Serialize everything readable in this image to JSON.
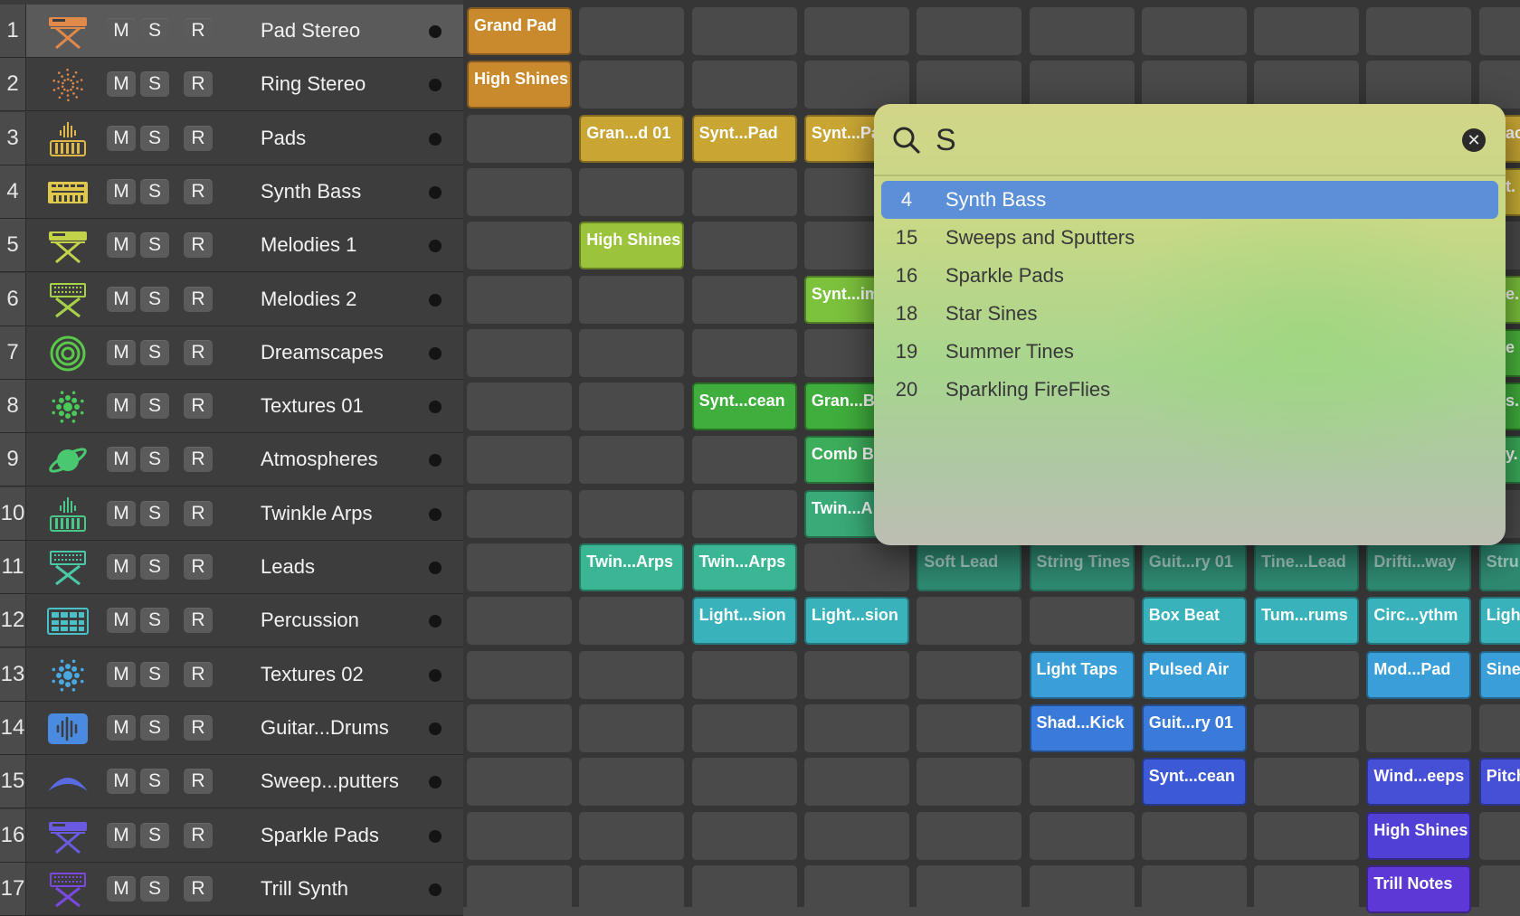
{
  "colors": {
    "yellow_orange": "#c98a2e",
    "gold": "#c9a634",
    "lime": "#9bc43c",
    "green": "#3fae3c",
    "green2": "#3cad5a",
    "teal_green": "#3aab78",
    "teal": "#39b2a2",
    "cyan": "#36a9c3",
    "sky": "#3a8ed8",
    "blue": "#3a6cd8",
    "indigo": "#4b4fd8",
    "violet": "#5d42d8",
    "selection": "#5b8fd8"
  },
  "tracks": [
    {
      "num": "1",
      "name": "Pad Stereo",
      "icon": "synth-stand-icon",
      "color": "#e0894a",
      "controls": [
        "M",
        "S",
        "R"
      ],
      "selected": true
    },
    {
      "num": "2",
      "name": "Ring Stereo",
      "icon": "dots-ring-icon",
      "color": "#e0894a",
      "controls": [
        "M",
        "S",
        "R"
      ]
    },
    {
      "num": "3",
      "name": "Pads",
      "icon": "keyboard-wave-icon",
      "color": "#e0b84a",
      "controls": [
        "M",
        "S",
        "R"
      ]
    },
    {
      "num": "4",
      "name": "Synth Bass",
      "icon": "synth-module-icon",
      "color": "#e0c84a",
      "controls": [
        "M",
        "S",
        "R"
      ]
    },
    {
      "num": "5",
      "name": "Melodies 1",
      "icon": "synth-stand-icon",
      "color": "#c2d24a",
      "controls": [
        "M",
        "S",
        "R"
      ]
    },
    {
      "num": "6",
      "name": "Melodies 2",
      "icon": "keyboard-stand-icon",
      "color": "#a6d24a",
      "controls": [
        "M",
        "S",
        "R"
      ]
    },
    {
      "num": "7",
      "name": "Dreamscapes",
      "icon": "spiral-icon",
      "color": "#5ac84a",
      "controls": [
        "M",
        "S",
        "R"
      ]
    },
    {
      "num": "8",
      "name": "Textures 01",
      "icon": "dots-burst-icon",
      "color": "#4ac85a",
      "controls": [
        "M",
        "S",
        "R"
      ]
    },
    {
      "num": "9",
      "name": "Atmospheres",
      "icon": "planet-icon",
      "color": "#4ac870",
      "controls": [
        "M",
        "S",
        "R"
      ]
    },
    {
      "num": "10",
      "name": "Twinkle Arps",
      "icon": "keyboard-wave-icon",
      "color": "#4ac88a",
      "controls": [
        "M",
        "S",
        "R"
      ]
    },
    {
      "num": "11",
      "name": "Leads",
      "icon": "keyboard-stand-icon",
      "color": "#4ac8a8",
      "controls": [
        "M",
        "S",
        "R"
      ]
    },
    {
      "num": "12",
      "name": "Percussion",
      "icon": "drum-pad-icon",
      "color": "#4ac0c8",
      "controls": [
        "M",
        "S",
        "R"
      ]
    },
    {
      "num": "13",
      "name": "Textures 02",
      "icon": "dots-burst-icon",
      "color": "#4aa8e0",
      "controls": [
        "M",
        "S",
        "R"
      ]
    },
    {
      "num": "14",
      "name": "Guitar...Drums",
      "icon": "waveform-box-icon",
      "color": "#4a8ae0",
      "controls": [
        "M",
        "S",
        "R"
      ]
    },
    {
      "num": "15",
      "name": "Sweep...putters",
      "icon": "swoosh-icon",
      "color": "#5a6ae0",
      "controls": [
        "M",
        "S",
        "R"
      ]
    },
    {
      "num": "16",
      "name": "Sparkle Pads",
      "icon": "synth-stand-icon",
      "color": "#6a5ae0",
      "controls": [
        "M",
        "S",
        "R"
      ]
    },
    {
      "num": "17",
      "name": "Trill Synth",
      "icon": "keyboard-stand-icon",
      "color": "#7a4ae0",
      "controls": [
        "M",
        "S",
        "R"
      ]
    }
  ],
  "clips": [
    {
      "row": 0,
      "col": 0,
      "label": "Grand Pad",
      "color": "#c98a2e"
    },
    {
      "row": 1,
      "col": 0,
      "label": "High Shines",
      "color": "#c98a2e"
    },
    {
      "row": 2,
      "col": 1,
      "label": "Gran...d 01",
      "color": "#c9a634"
    },
    {
      "row": 2,
      "col": 2,
      "label": "Synt...Pad",
      "color": "#c9a634"
    },
    {
      "row": 2,
      "col": 3,
      "label": "Synt...Pa",
      "color": "#c9a634"
    },
    {
      "row": 4,
      "col": 1,
      "label": "High Shines",
      "color": "#9bc43c"
    },
    {
      "row": 5,
      "col": 3,
      "label": "Synt...im",
      "color": "#7cc23c"
    },
    {
      "row": 7,
      "col": 2,
      "label": "Synt...cean",
      "color": "#3fae3c"
    },
    {
      "row": 7,
      "col": 3,
      "label": "Gran...B",
      "color": "#3fae3c"
    },
    {
      "row": 8,
      "col": 3,
      "label": "Comb B",
      "color": "#3cad5a"
    },
    {
      "row": 9,
      "col": 3,
      "label": "Twin...A",
      "color": "#3aab78"
    },
    {
      "row": 10,
      "col": 1,
      "label": "Twin...Arps",
      "color": "#3ab694"
    },
    {
      "row": 10,
      "col": 2,
      "label": "Twin...Arps",
      "color": "#3ab694"
    },
    {
      "row": 10,
      "col": 4,
      "label": "Soft Lead",
      "color": "#2f8a72",
      "dim": true
    },
    {
      "row": 10,
      "col": 5,
      "label": "String Tines",
      "color": "#2f8a72",
      "dim": true
    },
    {
      "row": 10,
      "col": 6,
      "label": "Guit...ry 01",
      "color": "#2f8a72",
      "dim": true
    },
    {
      "row": 10,
      "col": 7,
      "label": "Tine...Lead",
      "color": "#2f8a72",
      "dim": true
    },
    {
      "row": 10,
      "col": 8,
      "label": "Drifti...way",
      "color": "#2f8a72",
      "dim": true
    },
    {
      "row": 10,
      "col": 9,
      "label": "Stru...",
      "color": "#2f8a72",
      "dim": true
    },
    {
      "row": 11,
      "col": 2,
      "label": "Light...sion",
      "color": "#39b2bb"
    },
    {
      "row": 11,
      "col": 3,
      "label": "Light...sion",
      "color": "#39b2bb"
    },
    {
      "row": 11,
      "col": 6,
      "label": "Box Beat",
      "color": "#39b2bb"
    },
    {
      "row": 11,
      "col": 7,
      "label": "Tum...rums",
      "color": "#39b2bb"
    },
    {
      "row": 11,
      "col": 8,
      "label": "Circ...ythm",
      "color": "#39b2bb"
    },
    {
      "row": 11,
      "col": 9,
      "label": "Light",
      "color": "#39b2bb"
    },
    {
      "row": 12,
      "col": 5,
      "label": "Light Taps",
      "color": "#3a9ed8"
    },
    {
      "row": 12,
      "col": 6,
      "label": "Pulsed Air",
      "color": "#3a9ed8"
    },
    {
      "row": 12,
      "col": 8,
      "label": "Mod...Pad",
      "color": "#3a9ed8"
    },
    {
      "row": 12,
      "col": 9,
      "label": "Sine...",
      "color": "#3a9ed8"
    },
    {
      "row": 13,
      "col": 5,
      "label": "Shad...Kick",
      "color": "#3a7ad8"
    },
    {
      "row": 13,
      "col": 6,
      "label": "Guit...ry 01",
      "color": "#3a7ad8"
    },
    {
      "row": 14,
      "col": 6,
      "label": "Synt...cean",
      "color": "#3c5ad6"
    },
    {
      "row": 14,
      "col": 8,
      "label": "Wind...eeps",
      "color": "#4650d6"
    },
    {
      "row": 14,
      "col": 9,
      "label": "Pitch",
      "color": "#4650d6"
    },
    {
      "row": 15,
      "col": 8,
      "label": "High Shines",
      "color": "#5040d6"
    },
    {
      "row": 16,
      "col": 8,
      "label": "Trill Notes",
      "color": "#5d38d6"
    }
  ],
  "edge_peeks": [
    {
      "row": 2,
      "label": "ac",
      "color": "#c9a634"
    },
    {
      "row": 3,
      "label": "t.",
      "color": "#c9b034"
    },
    {
      "row": 5,
      "label": "e.",
      "color": "#7cc23c"
    },
    {
      "row": 6,
      "label": "e",
      "color": "#4ab43c"
    },
    {
      "row": 7,
      "label": "s.",
      "color": "#3fae3c"
    },
    {
      "row": 8,
      "label": "y.",
      "color": "#3cad5a"
    }
  ],
  "search": {
    "query": "S",
    "clear_symbol": "✕",
    "results": [
      {
        "num": "4",
        "name": "Synth Bass",
        "selected": true
      },
      {
        "num": "15",
        "name": "Sweeps and Sputters"
      },
      {
        "num": "16",
        "name": "Sparkle Pads"
      },
      {
        "num": "18",
        "name": "Star Sines"
      },
      {
        "num": "19",
        "name": "Summer Tines"
      },
      {
        "num": "20",
        "name": "Sparkling FireFlies"
      }
    ]
  }
}
